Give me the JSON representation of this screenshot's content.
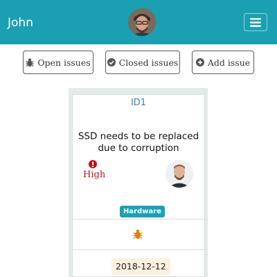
{
  "navbar": {
    "brand": "John",
    "avatar_icon": "user-avatar-icon",
    "menu_icon": "hamburger-menu-icon",
    "color": "#1a9fb3"
  },
  "filters": {
    "open_issues": {
      "label": "Open issues",
      "icon": "bug-icon"
    },
    "closed_issues": {
      "label": "Closed issues",
      "icon": "check-circle-icon"
    },
    "add_issue": {
      "label": "Add issue",
      "icon": "plus-circle-icon"
    }
  },
  "issue": {
    "id": "ID1",
    "title": "SSD needs to be replaced due to corruption",
    "priority": {
      "label": "High",
      "icon": "exclamation-circle-icon",
      "color": "#c0121b"
    },
    "assignee_icon": "assignee-avatar-icon",
    "category": {
      "label": "Hardware",
      "color": "#17a2b8"
    },
    "status_icon": "bug-icon",
    "status_color": "#d8870c",
    "date": "2018-12-12"
  }
}
